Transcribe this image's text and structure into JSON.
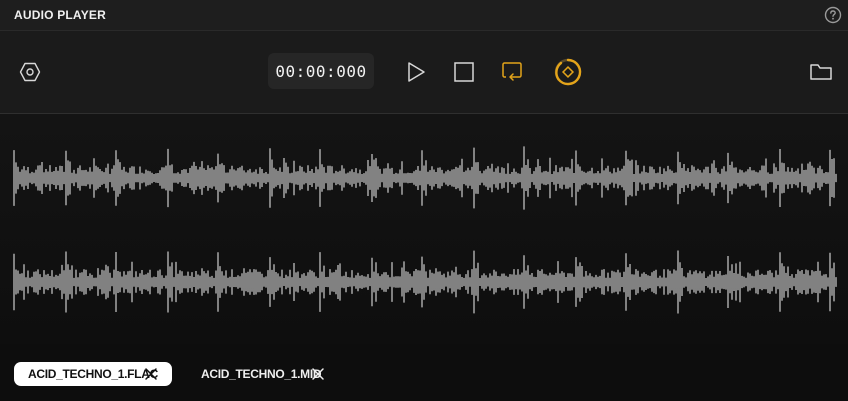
{
  "app": {
    "title": "AUDIO PLAYER"
  },
  "toolbar": {
    "time": "00:00:000",
    "colors": {
      "accent": "#e3a41a",
      "icon": "#d8d8d8"
    },
    "icons": [
      "settings-hexagon-icon",
      "play-icon",
      "stop-icon",
      "loop-icon",
      "speed-dial-icon",
      "folder-icon",
      "help-icon"
    ]
  },
  "tabs": [
    {
      "label": "ACID_TECHNO_1.FLAC",
      "active": true
    },
    {
      "label": "ACID_TECHNO_1.MID",
      "active": false
    }
  ]
}
